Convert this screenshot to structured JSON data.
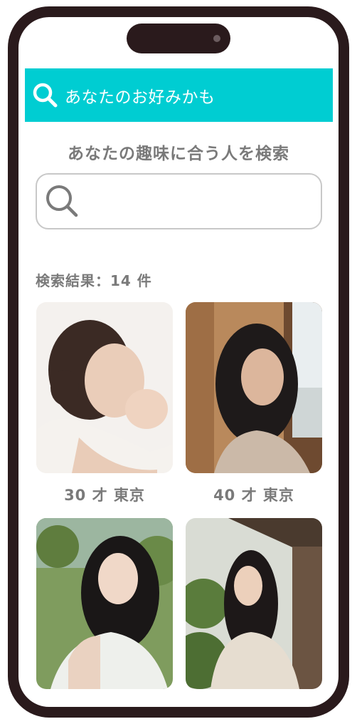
{
  "banner": {
    "text": "あなたのお好みかも",
    "icon": "search-icon",
    "color": "#00cdd2"
  },
  "search": {
    "heading": "あなたの趣味に合う人を検索",
    "input_value": "",
    "icon": "search-icon"
  },
  "results": {
    "count_label": "検索結果：14 件",
    "items": [
      {
        "caption": "30 才 東京"
      },
      {
        "caption": "40 才 東京"
      },
      {
        "caption": ""
      },
      {
        "caption": ""
      }
    ]
  }
}
